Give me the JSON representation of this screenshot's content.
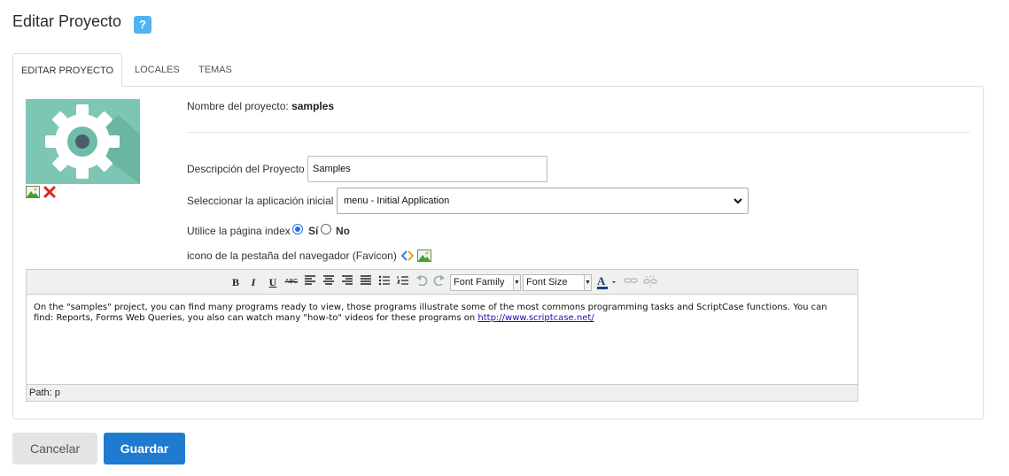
{
  "header": {
    "title": "Editar Proyecto",
    "help_icon": "?"
  },
  "tabs": [
    {
      "label": "EDITAR PROYECTO",
      "active": true
    },
    {
      "label": "LOCALES",
      "active": false
    },
    {
      "label": "TEMAS",
      "active": false
    }
  ],
  "image": {
    "icon": "gear-icon",
    "actions": [
      "image-icon",
      "delete-icon"
    ]
  },
  "form": {
    "project_name_label": "Nombre del proyecto:",
    "project_name_value": "samples",
    "description_label": "Descripción del Proyecto",
    "description_value": "Samples",
    "initial_app_label": "Seleccionar la aplicación inicial",
    "initial_app_value": "menu - Initial Application",
    "use_index_label": "Utilice la página index",
    "use_index_yes": "Sí",
    "use_index_no": "No",
    "use_index_selected": "Sí",
    "favicon_label": "icono de la pestaña del navegador (Favicon)"
  },
  "editor": {
    "toolbar": {
      "bold": "B",
      "italic": "I",
      "underline": "U",
      "strikethrough": "ABC",
      "font_family": "Font Family",
      "font_size": "Font Size"
    },
    "content_parts": [
      "On the \"samples\" project, you can find many programs ready to view, those programs illustrate some of the most commons programming tasks and ScriptCase functions. You can find: Reports, Forms Web Queries, you also can watch many \"how-to\" videos for these programs on ",
      "http://www.scriptcase.net/"
    ],
    "path": "Path: p"
  },
  "buttons": {
    "cancel": "Cancelar",
    "save": "Guardar"
  },
  "colors": {
    "primary": "#1f7bcf",
    "help": "#4fb3f0",
    "image_bg": "#7dc6b4"
  }
}
